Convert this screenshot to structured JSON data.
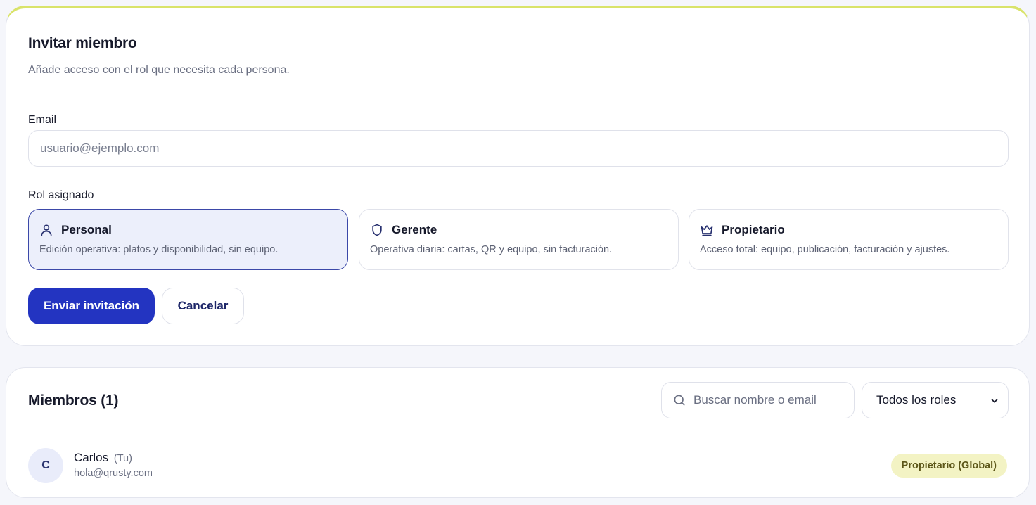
{
  "invite": {
    "title": "Invitar miembro",
    "subtitle": "Añade acceso con el rol que necesita cada persona.",
    "email_label": "Email",
    "email_placeholder": "usuario@ejemplo.com",
    "email_value": "",
    "role_label": "Rol asignado",
    "roles": [
      {
        "icon": "user-icon",
        "name": "Personal",
        "description": "Edición operativa: platos y disponibilidad, sin equipo.",
        "selected": true
      },
      {
        "icon": "shield-icon",
        "name": "Gerente",
        "description": "Operativa diaria: cartas, QR y equipo, sin facturación.",
        "selected": false
      },
      {
        "icon": "crown-icon",
        "name": "Propietario",
        "description": "Acceso total: equipo, publicación, facturación y ajustes.",
        "selected": false
      }
    ],
    "submit_label": "Enviar invitación",
    "cancel_label": "Cancelar"
  },
  "members": {
    "title": "Miembros (1)",
    "search_placeholder": "Buscar nombre o email",
    "role_filter": {
      "selected": "Todos los roles"
    },
    "list": [
      {
        "initial": "C",
        "name": "Carlos",
        "you_label": "(Tu)",
        "email": "hola@qrusty.com",
        "badge": "Propietario (Global)"
      }
    ]
  },
  "colors": {
    "accent": "#2334c1",
    "top_border": "#d9e36a",
    "selected_role_bg": "#eceffb",
    "badge_bg": "#f3f3c4"
  }
}
